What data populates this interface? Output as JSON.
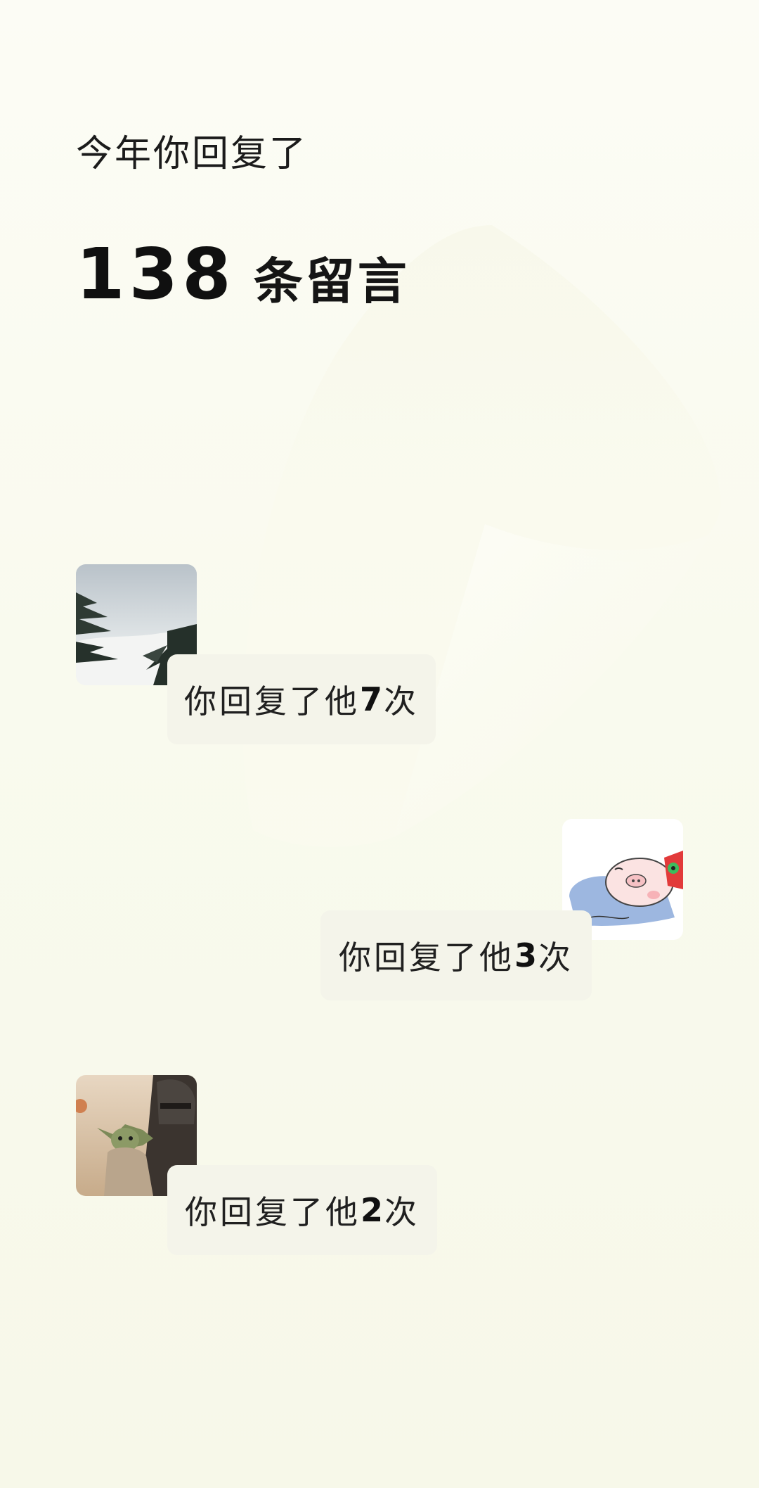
{
  "summary": {
    "intro": "今年你回复了",
    "count": "138",
    "unit": "条留言"
  },
  "replies": [
    {
      "avatar": "avatar-landscape-pine-clouds",
      "prefix": "你回复了他",
      "count": "7",
      "suffix": "次"
    },
    {
      "avatar": "avatar-cartoon-pig-lion-dance",
      "prefix": "你回复了他",
      "count": "3",
      "suffix": "次"
    },
    {
      "avatar": "avatar-baby-yoda-mandalorian",
      "prefix": "你回复了他",
      "count": "2",
      "suffix": "次"
    }
  ],
  "colors": {
    "background": "#f9faee",
    "bubble": "#f4f4ea",
    "text": "#111111"
  }
}
